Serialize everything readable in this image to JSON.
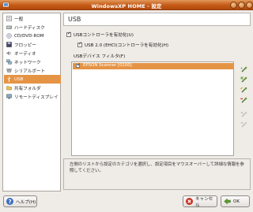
{
  "window": {
    "title": "WindowsXP HOME - 設定"
  },
  "sidebar": {
    "items": [
      {
        "label": "一般",
        "icon": "general-icon"
      },
      {
        "label": "ハードディスク",
        "icon": "hard-disk-icon"
      },
      {
        "label": "CD/DVD-ROM",
        "icon": "cd-dvd-icon"
      },
      {
        "label": "フロッピー",
        "icon": "floppy-icon"
      },
      {
        "label": "オーディオ",
        "icon": "audio-icon"
      },
      {
        "label": "ネットワーク",
        "icon": "network-icon"
      },
      {
        "label": "シリアルポート",
        "icon": "serial-port-icon"
      },
      {
        "label": "USB",
        "icon": "usb-icon"
      },
      {
        "label": "共有フォルダ",
        "icon": "shared-folder-icon"
      },
      {
        "label": "リモートディスプレイ",
        "icon": "remote-display-icon"
      }
    ],
    "selected_index": 7
  },
  "panel": {
    "title": "USB",
    "enable_usb_label": "USBコントローラを有効化(U)",
    "enable_usb_checked": true,
    "enable_ehci_label": "USB 2.0 (EHCI)コントローラを有効化(H)",
    "enable_ehci_checked": true,
    "filter_label": "USBデバイス フィルタ(F)",
    "filters": [
      {
        "name": "EPSON Scanner [0100]",
        "checked": true
      }
    ]
  },
  "info_text": "左側のリストから設定のカテゴリを選択し、設定項目をマウスオーバーして詳細な情報を参照してください。",
  "buttons": {
    "help": "ヘルプ(H)",
    "cancel": "キャンセル",
    "ok": "OK"
  },
  "colors": {
    "selection": "#e59445",
    "titlebar": "#c55a16"
  }
}
